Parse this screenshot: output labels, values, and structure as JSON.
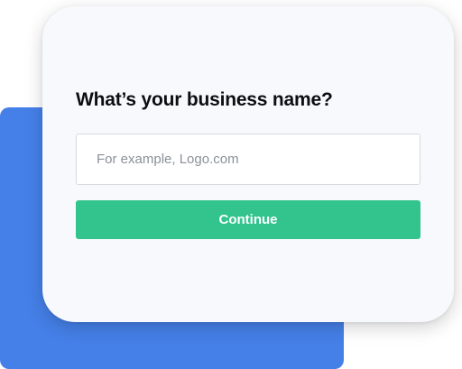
{
  "form": {
    "title": "What’s your business name?",
    "input_value": "",
    "input_placeholder": "For example, Logo.com",
    "continue_label": "Continue"
  },
  "colors": {
    "accent_blue": "#4580e8",
    "button_green": "#33c48d",
    "card_background": "#f7f9fc",
    "title_text": "#0e0e12"
  }
}
